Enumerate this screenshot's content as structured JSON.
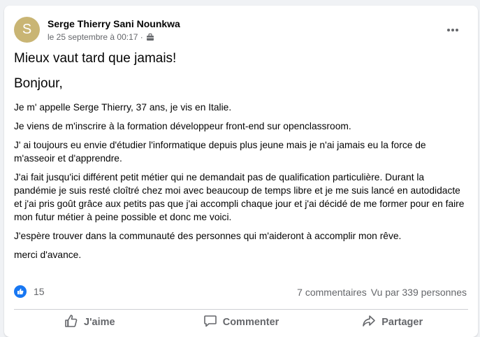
{
  "post": {
    "avatar_letter": "S",
    "author": "Serge Thierry Sani Nounkwa",
    "date": "le 25 septembre à 00:17 ·",
    "title": "Mieux vaut tard que jamais!",
    "greeting": "Bonjour,",
    "paragraphs": [
      "Je m' appelle Serge Thierry, 37 ans, je vis en Italie.",
      "Je viens de m'inscrire à la formation développeur front-end sur openclassroom.",
      "J' ai toujours eu envie d'étudier l'informatique depuis plus jeune mais je n'ai jamais eu la force de m'asseoir et d'apprendre.",
      "J'ai fait jusqu'ici différent petit métier qui ne demandait pas de qualification particulière. Durant la pandémie je suis resté cloîtré chez moi avec beaucoup de temps libre et je me suis lancé en autodidacte et j'ai pris goût grâce aux petits pas que j'ai accompli chaque jour et j'ai décidé de me former pour en faire mon futur métier à peine possible et donc me voici.",
      "J'espère trouver dans la communauté des personnes qui m'aideront à accomplir mon rêve.",
      "merci d'avance."
    ]
  },
  "stats": {
    "reactions_count": "15",
    "comments": "7 commentaires",
    "views": "Vu par 339 personnes"
  },
  "actions": {
    "like": "J'aime",
    "comment": "Commenter",
    "share": "Partager"
  },
  "colors": {
    "accent": "#1877f2",
    "secondary_text": "#65676b",
    "avatar_bg": "#c9b574"
  },
  "icons": {
    "privacy": "members-group-icon",
    "more": "more-dots-icon",
    "reaction": "like-reaction-icon",
    "like": "thumbs-up-icon",
    "comment": "comment-bubble-icon",
    "share": "share-arrow-icon"
  }
}
